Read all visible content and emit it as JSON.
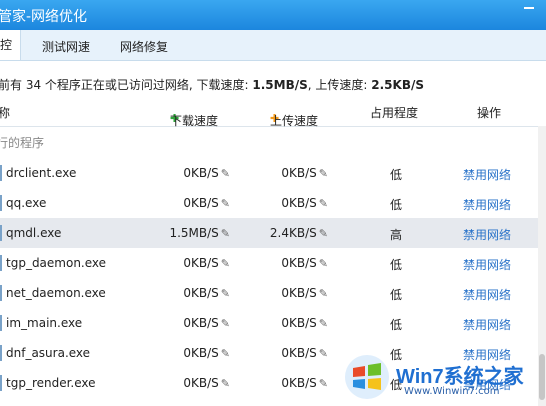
{
  "window": {
    "title": "管家-网络优化"
  },
  "tabs": [
    {
      "label": "控"
    },
    {
      "label": "测试网速"
    },
    {
      "label": "网络修复"
    }
  ],
  "summary": {
    "prefix": "前有 34 个程序正在或已访问过网络, 下载速度: ",
    "download": "1.5MB/S",
    "middle": ", 上传速度: ",
    "upload": "2.5KB/S"
  },
  "table": {
    "headers": {
      "name": "称",
      "download": "下载速度",
      "upload": "上传速度",
      "usage": "占用程度",
      "action": "操作"
    },
    "group": "行的程序",
    "rows": [
      {
        "name": "drclient.exe",
        "download": "0KB/S",
        "upload": "0KB/S",
        "usage": "低",
        "action": "禁用网络"
      },
      {
        "name": "qq.exe",
        "download": "0KB/S",
        "upload": "0KB/S",
        "usage": "低",
        "action": "禁用网络"
      },
      {
        "name": "qmdl.exe",
        "download": "1.5MB/S",
        "upload": "2.4KB/S",
        "usage": "高",
        "action": "禁用网络"
      },
      {
        "name": "tgp_daemon.exe",
        "download": "0KB/S",
        "upload": "0KB/S",
        "usage": "低",
        "action": "禁用网络"
      },
      {
        "name": "net_daemon.exe",
        "download": "0KB/S",
        "upload": "0KB/S",
        "usage": "低",
        "action": "禁用网络"
      },
      {
        "name": "im_main.exe",
        "download": "0KB/S",
        "upload": "0KB/S",
        "usage": "低",
        "action": "禁用网络"
      },
      {
        "name": "dnf_asura.exe",
        "download": "0KB/S",
        "upload": "0KB/S",
        "usage": "低",
        "action": "禁用网络"
      },
      {
        "name": "tgp_render.exe",
        "download": "0KB/S",
        "upload": "0KB/S",
        "usage": "低",
        "action": "禁用网络"
      }
    ]
  },
  "watermark": {
    "brand": "Win7系统之家",
    "url": "Www.Winwin7.com"
  },
  "icons": {
    "pencil": "pencil-icon",
    "download_arrow": "download-arrow-icon",
    "upload_arrow": "upload-arrow-icon"
  },
  "colors": {
    "accent": "#1c86de",
    "link": "#2a73c9",
    "download_arrow": "#2fa53a",
    "upload_arrow": "#f39a1b"
  }
}
